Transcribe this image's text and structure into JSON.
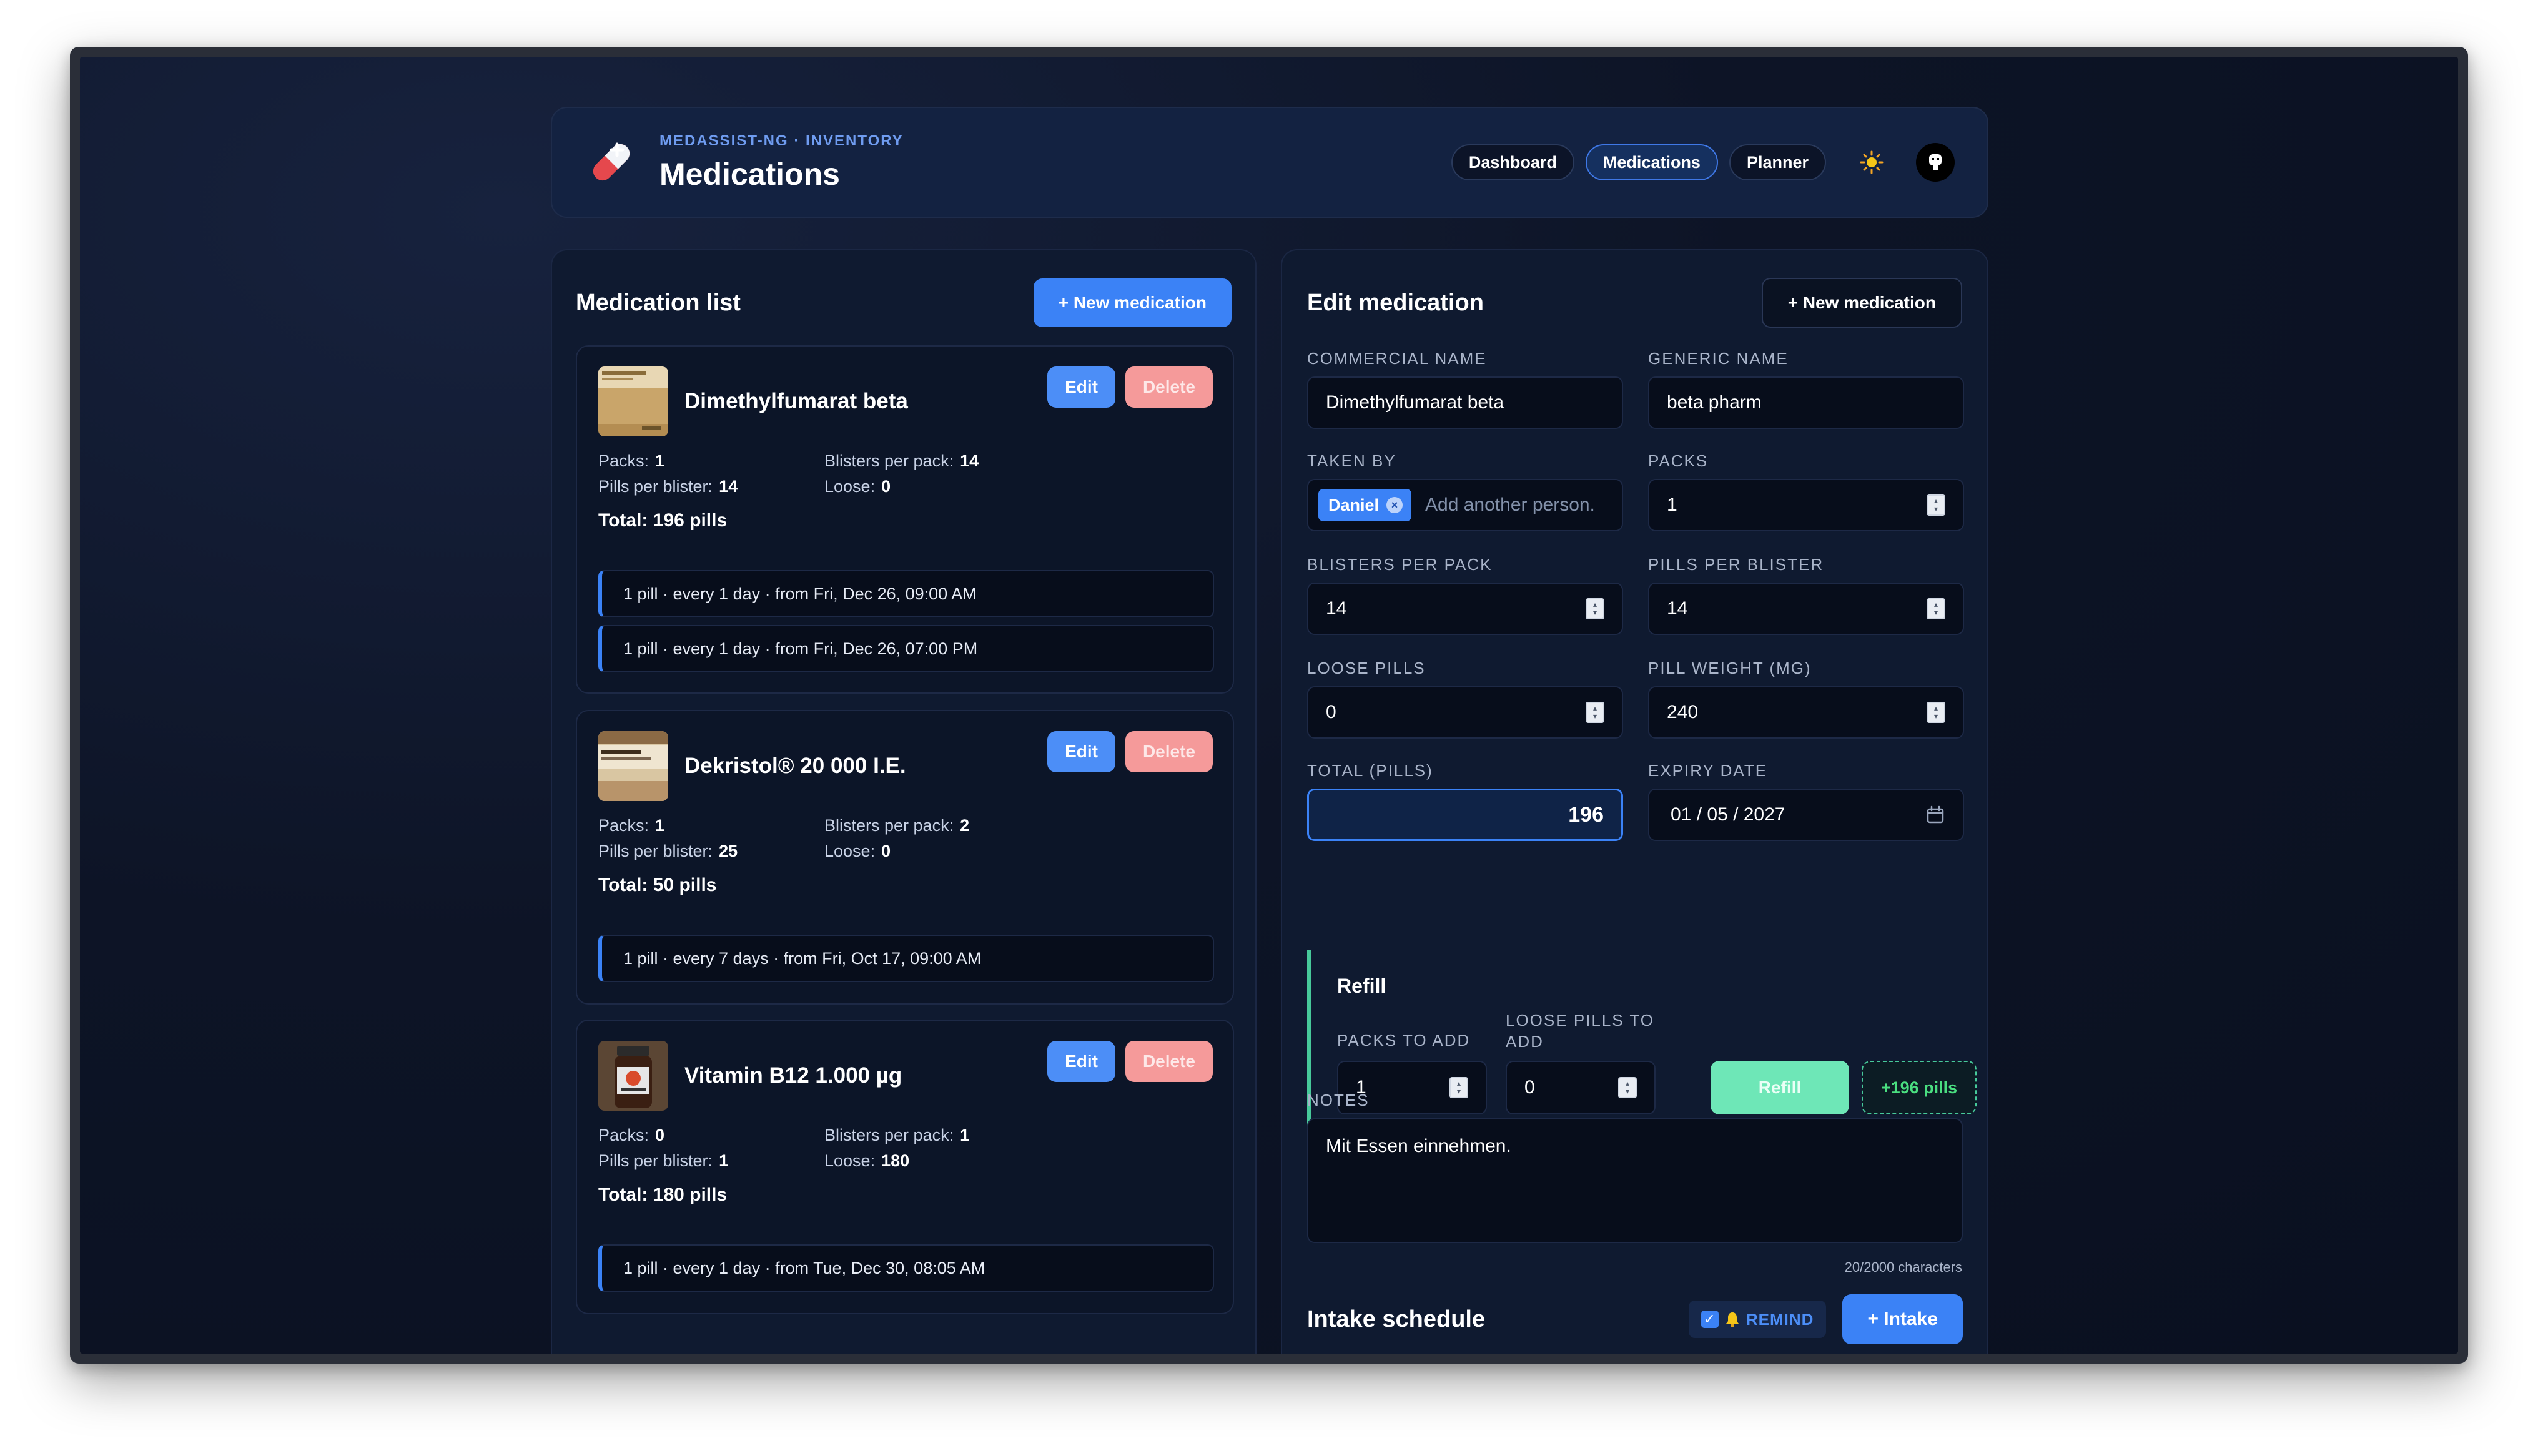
{
  "header": {
    "kicker": "MEDASSIST-NG · INVENTORY",
    "title": "Medications",
    "nav": [
      "Dashboard",
      "Medications",
      "Planner"
    ],
    "active_nav": "Medications",
    "icons": {
      "logo": "pill-capsule-icon",
      "theme": "sun-icon",
      "avatar": "user-avatar-icon"
    }
  },
  "list": {
    "title": "Medication list",
    "new_button": "+ New medication",
    "edit_label": "Edit",
    "delete_label": "Delete",
    "labels": {
      "packs": "Packs:",
      "blisters_per_pack": "Blisters per pack:",
      "pills_per_blister": "Pills per blister:",
      "loose": "Loose:"
    },
    "medications": [
      {
        "name": "Dimethylfumarat beta",
        "packs": "1",
        "blisters_per_pack": "14",
        "pills_per_blister": "14",
        "loose": "0",
        "total": "Total: 196 pills",
        "schedules": [
          "1 pill · every 1 day · from Fri, Dec 26, 09:00 AM",
          "1 pill · every 1 day · from Fri, Dec 26, 07:00 PM"
        ]
      },
      {
        "name": "Dekristol® 20 000 I.E.",
        "packs": "1",
        "blisters_per_pack": "2",
        "pills_per_blister": "25",
        "loose": "0",
        "total": "Total: 50 pills",
        "schedules": [
          "1 pill · every 7 days · from Fri, Oct 17, 09:00 AM"
        ]
      },
      {
        "name": "Vitamin B12 1.000 µg",
        "packs": "0",
        "blisters_per_pack": "1",
        "pills_per_blister": "1",
        "loose": "180",
        "total": "Total: 180 pills",
        "schedules": [
          "1 pill · every 1 day · from Tue, Dec 30, 08:05 AM"
        ]
      }
    ]
  },
  "editor": {
    "title": "Edit medication",
    "new_button": "+ New medication",
    "fields": {
      "commercial_name": {
        "label": "COMMERCIAL NAME",
        "value": "Dimethylfumarat beta"
      },
      "generic_name": {
        "label": "GENERIC NAME",
        "value": "beta pharm"
      },
      "taken_by": {
        "label": "TAKEN BY",
        "chip": "Daniel",
        "placeholder": "Add another person."
      },
      "packs": {
        "label": "PACKS",
        "value": "1"
      },
      "blisters_per_pack": {
        "label": "BLISTERS PER PACK",
        "value": "14"
      },
      "pills_per_blister": {
        "label": "PILLS PER BLISTER",
        "value": "14"
      },
      "loose_pills": {
        "label": "LOOSE PILLS",
        "value": "0"
      },
      "pill_weight": {
        "label": "PILL WEIGHT (MG)",
        "value": "240"
      },
      "total": {
        "label": "TOTAL (PILLS)",
        "value": "196"
      },
      "expiry_date": {
        "label": "EXPIRY DATE",
        "value": "01 / 05 / 2027"
      }
    },
    "refill": {
      "title": "Refill",
      "packs_label": "PACKS TO ADD",
      "packs_value": "1",
      "loose_label_1": "LOOSE PILLS TO",
      "loose_label_2": "ADD",
      "loose_value": "0",
      "button": "Refill",
      "badge": "+196 pills"
    },
    "notes": {
      "label": "NOTES",
      "value": "Mit Essen einnehmen.",
      "count": "20/2000 characters"
    },
    "intake": {
      "title": "Intake schedule",
      "remind": "REMIND",
      "remind_checked": true,
      "button": "+ Intake"
    }
  },
  "colors": {
    "accent": "#3b82f6",
    "danger": "#f59a9a",
    "success": "#6ee7b7",
    "background": "#0d1426"
  }
}
